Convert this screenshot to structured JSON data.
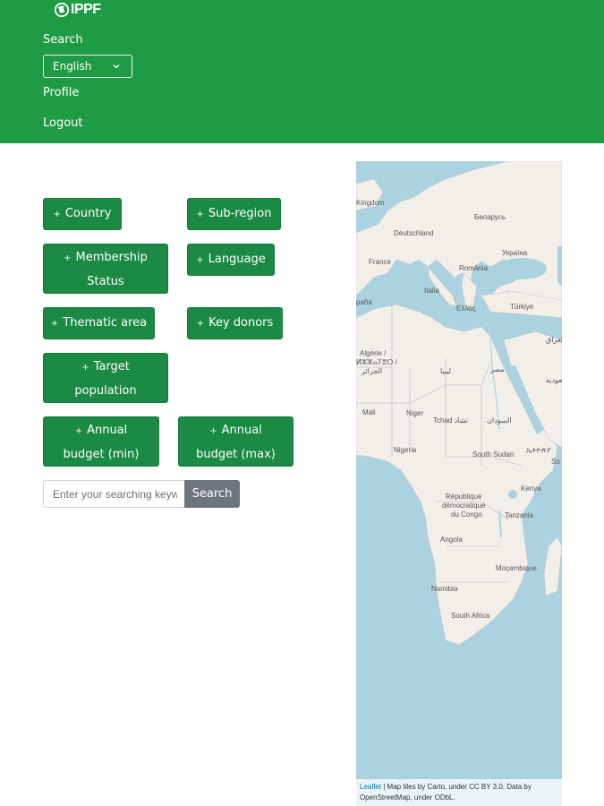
{
  "header": {
    "logo_text": "IPPF",
    "nav": {
      "search": "Search",
      "profile": "Profile",
      "logout": "Logout"
    },
    "language": {
      "selected": "English"
    }
  },
  "filters": {
    "country": "Country",
    "sub_region": "Sub-region",
    "membership_status_line1": "Membership",
    "membership_status_line2": "Status",
    "language": "Language",
    "thematic_area": "Thematic area",
    "key_donors": "Key donors",
    "target_population_line1": "Target",
    "target_population_line2": "population",
    "annual_budget_min_line1": "Annual",
    "annual_budget_min_line2": "budget (min)",
    "annual_budget_max_line1": "Annual",
    "annual_budget_max_line2": "budget (max)",
    "plus_glyph": "+"
  },
  "search": {
    "placeholder": "Enter your searching keyword",
    "button": "Search"
  },
  "map": {
    "labels": {
      "kingdom": "Kingdom",
      "belarus": "Беларусь",
      "deutschland": "Deutschland",
      "ukraine": "Україна",
      "france": "France",
      "romania": "România",
      "italia": "Italia",
      "espana": "paña",
      "ellada": "Ελλάς",
      "turkiye": "Türkiye",
      "iraq": "العراق",
      "algerie1": "Algérie /",
      "algerie2": "ⵍⵣⵣⴰⵢⴻⵔ /",
      "algerie3": "الجزائر",
      "libya": "ليبيا",
      "egypt": "مصر",
      "saudi": "السعودية",
      "mali": "Mali",
      "niger": "Niger",
      "tchad": "Tchad تشاد",
      "sudan": "السودان",
      "ethiopia": "ኢትዮጵያ",
      "nigeria": "Nigeria",
      "south_sudan": "South Sudan",
      "somalia": "So",
      "drc1": "République",
      "drc2": "démocratique",
      "drc3": "du Congo",
      "kenya": "Kenya",
      "tanzania": "Tanzania",
      "angola": "Angola",
      "mozambique": "Moçambique",
      "namibia": "Namibia",
      "south_africa": "South Africa"
    },
    "attribution": {
      "leaflet": "Leaflet",
      "line1": " | Map tiles by Carto, under CC BY 3.0. Data by",
      "line2": "OpenStreetMap, under ODbL."
    },
    "colors": {
      "water": "#aad3df",
      "land": "#f2efe9",
      "border": "#b9b2bf"
    }
  },
  "colors": {
    "header_bg": "#1e9b44",
    "button_bg": "#1a8a45",
    "search_button_bg": "#6c757d"
  }
}
